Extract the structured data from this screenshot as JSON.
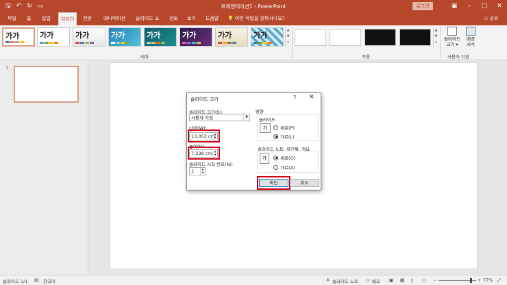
{
  "titlebar": {
    "title": "프레젠테이션1 - PowerPoint",
    "login_label": "로그인",
    "qat_icons": [
      "save-icon",
      "undo-icon",
      "redo-icon",
      "slideshow-icon"
    ]
  },
  "tabs": [
    {
      "label": "파일"
    },
    {
      "label": "홈"
    },
    {
      "label": "삽입"
    },
    {
      "label": "디자인"
    },
    {
      "label": "전환"
    },
    {
      "label": "애니메이션"
    },
    {
      "label": "슬라이드 쇼"
    },
    {
      "label": "검토"
    },
    {
      "label": "보기"
    },
    {
      "label": "도움말"
    }
  ],
  "active_tab": "디자인",
  "search_placeholder": "어떤 작업을 원하시나요?",
  "share_label": "공유",
  "ribbon": {
    "theme_sample_text": "가가",
    "theme_group_label": "테마",
    "variants_group_label": "적용",
    "slide_size_label_1": "슬라이드",
    "slide_size_label_2": "크기 ▾",
    "background_label_1": "배경",
    "background_label_2": "서식",
    "custom_group_label": "사용자 지정"
  },
  "slides_pane": {
    "slide_number": "1"
  },
  "status": {
    "slide_info": "슬라이드 1/1",
    "language": "한국어",
    "notes_label": "슬라이드 노트",
    "comments_label": "메모",
    "zoom": "77%"
  },
  "dialog": {
    "title": "슬라이드 크기",
    "help": "?",
    "slide_size_for_label": "슬라이드 크기(S):",
    "slide_size_value": "사용자 지정",
    "width_label": "너비(W):",
    "width_value": "13.053 cm",
    "height_label": "높이(H):",
    "height_value": "7.338 cm",
    "start_number_label": "슬라이드 시작 번호(N):",
    "start_number_value": "1",
    "orientation_label": "방향",
    "slides_label": "슬라이드",
    "slides_portrait": "세로(P)",
    "slides_landscape": "가로(L)",
    "notes_label": "슬라이드 노트, 유인물, 개요",
    "notes_portrait": "세로(O)",
    "notes_landscape": "가로(A)",
    "page_icon_text": "가",
    "ok_label": "확인",
    "cancel_label": "취소"
  },
  "colors": {
    "accent": "#b7472a",
    "highlight": "#d0021b"
  }
}
